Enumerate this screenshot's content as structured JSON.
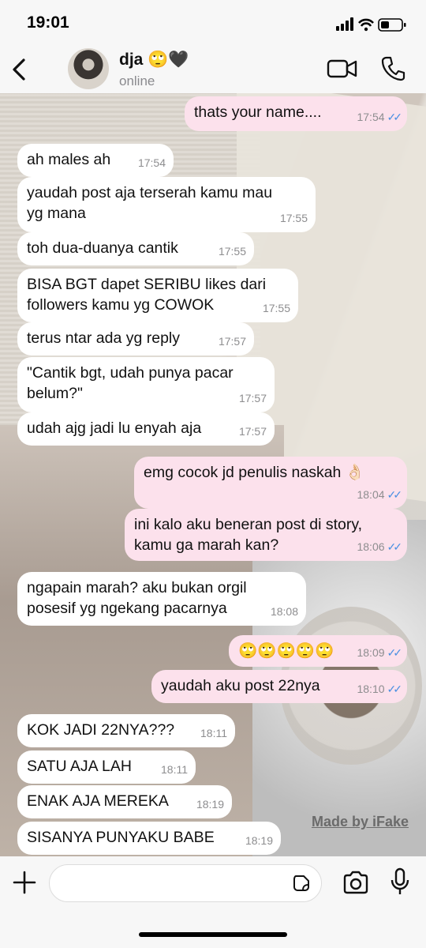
{
  "status": {
    "time": "19:01"
  },
  "header": {
    "name": "dja",
    "name_emoji": "🙄🖤",
    "status": "online"
  },
  "messages": [
    {
      "dir": "out",
      "text": "thats your name....",
      "time": "17:54",
      "read": true
    },
    {
      "dir": "in",
      "text": "ah males ah",
      "time": "17:54"
    },
    {
      "dir": "in",
      "text": "yaudah post aja terserah kamu mau\nyg mana",
      "time": "17:55"
    },
    {
      "dir": "in",
      "text": "toh dua-duanya cantik",
      "time": "17:55"
    },
    {
      "dir": "in",
      "text": "BISA BGT dapet SERIBU likes dari\nfollowers kamu yg COWOK",
      "time": "17:55"
    },
    {
      "dir": "in",
      "text": "terus ntar ada yg reply",
      "time": "17:57"
    },
    {
      "dir": "in",
      "text": "\"Cantik bgt, udah punya pacar\nbelum?\"",
      "time": "17:57"
    },
    {
      "dir": "in",
      "text": "udah ajg jadi lu enyah aja",
      "time": "17:57"
    },
    {
      "dir": "out",
      "text": "emg cocok jd penulis naskah 👌🏻",
      "time": "18:04",
      "read": true
    },
    {
      "dir": "out",
      "text": "ini kalo aku beneran post di story,\nkamu ga marah kan?",
      "time": "18:06",
      "read": true
    },
    {
      "dir": "in",
      "text": "ngapain marah? aku bukan orgil\nposesif yg ngekang pacarnya",
      "time": "18:08"
    },
    {
      "dir": "out",
      "text": "🙄🙄🙄🙄🙄",
      "time": "18:09",
      "read": true
    },
    {
      "dir": "out",
      "text": "yaudah aku post 22nya",
      "time": "18:10",
      "read": true
    },
    {
      "dir": "in",
      "text": "KOK JADI 22NYA???",
      "time": "18:11"
    },
    {
      "dir": "in",
      "text": "SATU AJA LAH",
      "time": "18:11"
    },
    {
      "dir": "in",
      "text": "ENAK AJA MEREKA",
      "time": "18:19"
    },
    {
      "dir": "in",
      "text": "SISANYA PUNYAKU BABE",
      "time": "18:19"
    }
  ],
  "watermark": "Made by iFake",
  "composer": {
    "placeholder": ""
  },
  "colors": {
    "incoming": "#ffffff",
    "outgoing": "#fce1ec",
    "read_tick": "#4a90e2"
  }
}
